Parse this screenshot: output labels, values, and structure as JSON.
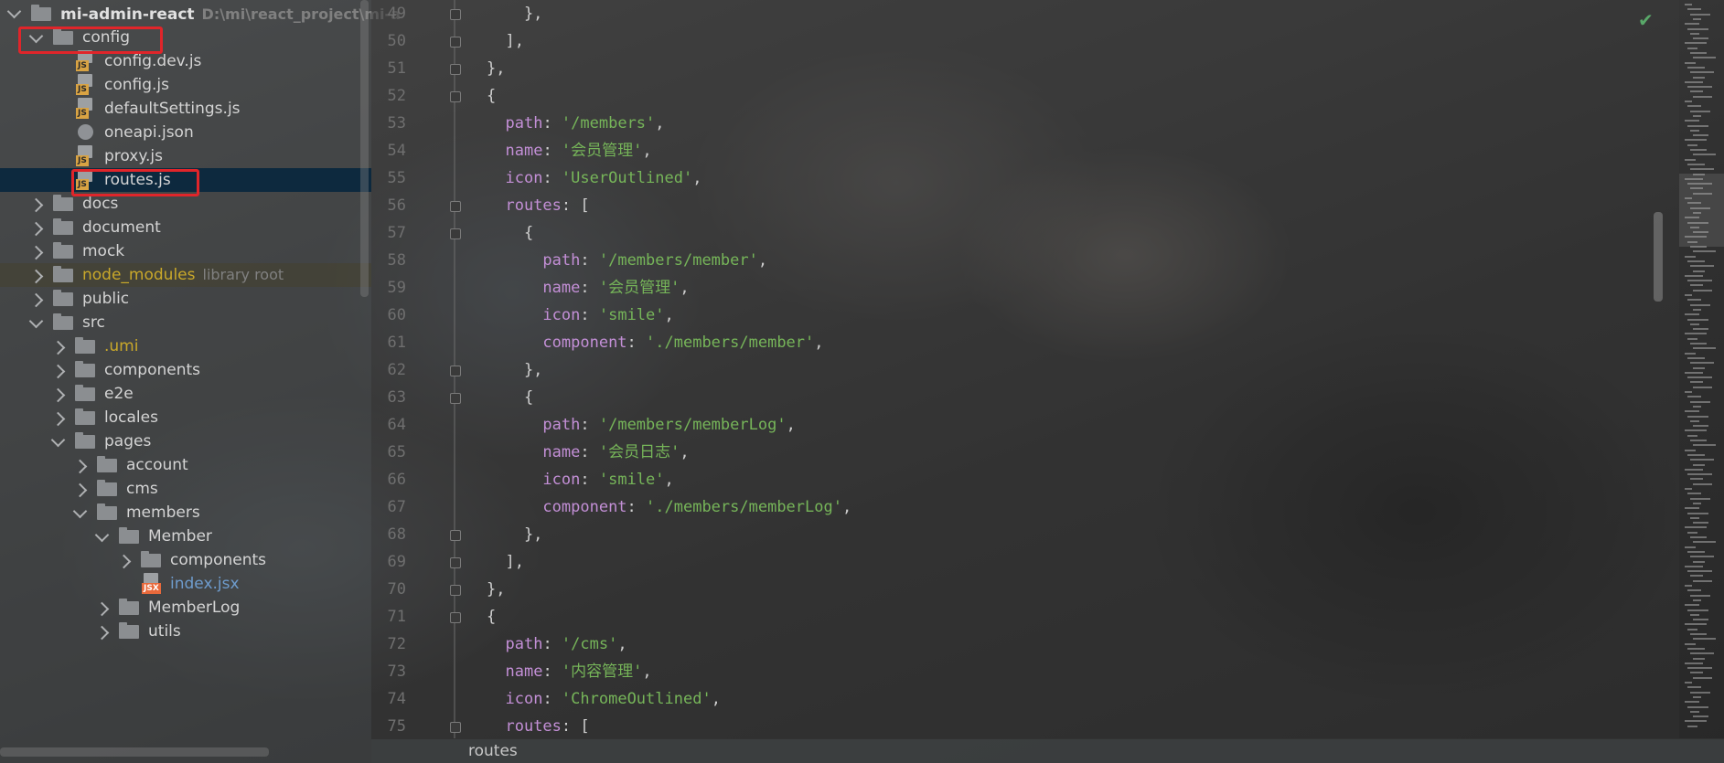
{
  "project_tree": {
    "root": {
      "name": "mi-admin-react",
      "path": "D:\\mi\\react_project\\mi-a"
    },
    "items": [
      {
        "label": "config",
        "kind": "folder",
        "expanded": true,
        "depth": 1
      },
      {
        "label": "config.dev.js",
        "kind": "js",
        "depth": 2
      },
      {
        "label": "config.js",
        "kind": "js",
        "depth": 2
      },
      {
        "label": "defaultSettings.js",
        "kind": "js",
        "depth": 2
      },
      {
        "label": "oneapi.json",
        "kind": "json",
        "depth": 2
      },
      {
        "label": "proxy.js",
        "kind": "js",
        "depth": 2
      },
      {
        "label": "routes.js",
        "kind": "js",
        "depth": 2,
        "selected": true
      },
      {
        "label": "docs",
        "kind": "folder",
        "expanded": false,
        "depth": 1
      },
      {
        "label": "document",
        "kind": "folder",
        "expanded": false,
        "depth": 1
      },
      {
        "label": "mock",
        "kind": "folder",
        "expanded": false,
        "depth": 1
      },
      {
        "label": "node_modules",
        "secondary": "library root",
        "kind": "folder",
        "expanded": false,
        "depth": 1
      },
      {
        "label": "public",
        "kind": "folder",
        "expanded": false,
        "depth": 1
      },
      {
        "label": "src",
        "kind": "folder",
        "expanded": true,
        "depth": 1
      },
      {
        "label": ".umi",
        "kind": "folder",
        "expanded": false,
        "depth": 2
      },
      {
        "label": "components",
        "kind": "folder",
        "expanded": false,
        "depth": 2
      },
      {
        "label": "e2e",
        "kind": "folder",
        "expanded": false,
        "depth": 2
      },
      {
        "label": "locales",
        "kind": "folder",
        "expanded": false,
        "depth": 2
      },
      {
        "label": "pages",
        "kind": "folder",
        "expanded": true,
        "depth": 2
      },
      {
        "label": "account",
        "kind": "folder",
        "expanded": false,
        "depth": 3
      },
      {
        "label": "cms",
        "kind": "folder",
        "expanded": false,
        "depth": 3
      },
      {
        "label": "members",
        "kind": "folder",
        "expanded": true,
        "depth": 3
      },
      {
        "label": "Member",
        "kind": "folder",
        "expanded": true,
        "depth": 4
      },
      {
        "label": "components",
        "kind": "folder",
        "expanded": false,
        "depth": 5
      },
      {
        "label": "index.jsx",
        "kind": "jsx",
        "depth": 5
      },
      {
        "label": "MemberLog",
        "kind": "folder",
        "expanded": false,
        "depth": 4
      },
      {
        "label": "utils",
        "kind": "folder",
        "expanded": false,
        "depth": 4
      }
    ]
  },
  "editor": {
    "lines": [
      {
        "n": "49",
        "code": "    },",
        "tokens": []
      },
      {
        "n": "50",
        "code": "  ],",
        "tokens": []
      },
      {
        "n": "51",
        "code": "},",
        "tokens": []
      },
      {
        "n": "52",
        "code": "{",
        "tokens": []
      },
      {
        "n": "53",
        "indent": "  ",
        "key": "path",
        "value": "'/members'",
        "tail": ","
      },
      {
        "n": "54",
        "indent": "  ",
        "key": "name",
        "value": "'会员管理'",
        "tail": ","
      },
      {
        "n": "55",
        "indent": "  ",
        "key": "icon",
        "value": "'UserOutlined'",
        "tail": ","
      },
      {
        "n": "56",
        "indent": "  ",
        "key": "routes",
        "value": "",
        "tail": " ["
      },
      {
        "n": "57",
        "code": "    {",
        "tokens": []
      },
      {
        "n": "58",
        "indent": "      ",
        "key": "path",
        "value": "'/members/member'",
        "tail": ","
      },
      {
        "n": "59",
        "indent": "      ",
        "key": "name",
        "value": "'会员管理'",
        "tail": ","
      },
      {
        "n": "60",
        "indent": "      ",
        "key": "icon",
        "value": "'smile'",
        "tail": ","
      },
      {
        "n": "61",
        "indent": "      ",
        "key": "component",
        "value": "'./members/member'",
        "tail": ","
      },
      {
        "n": "62",
        "code": "    },",
        "tokens": []
      },
      {
        "n": "63",
        "code": "    {",
        "tokens": []
      },
      {
        "n": "64",
        "indent": "      ",
        "key": "path",
        "value": "'/members/memberLog'",
        "tail": ","
      },
      {
        "n": "65",
        "indent": "      ",
        "key": "name",
        "value": "'会员日志'",
        "tail": ","
      },
      {
        "n": "66",
        "indent": "      ",
        "key": "icon",
        "value": "'smile'",
        "tail": ","
      },
      {
        "n": "67",
        "indent": "      ",
        "key": "component",
        "value": "'./members/memberLog'",
        "tail": ","
      },
      {
        "n": "68",
        "code": "    },",
        "tokens": []
      },
      {
        "n": "69",
        "code": "  ],",
        "tokens": []
      },
      {
        "n": "70",
        "code": "},",
        "tokens": []
      },
      {
        "n": "71",
        "code": "{",
        "tokens": []
      },
      {
        "n": "72",
        "indent": "  ",
        "key": "path",
        "value": "'/cms'",
        "tail": ","
      },
      {
        "n": "73",
        "indent": "  ",
        "key": "name",
        "value": "'内容管理'",
        "tail": ","
      },
      {
        "n": "74",
        "indent": "  ",
        "key": "icon",
        "value": "'ChromeOutlined'",
        "tail": ","
      },
      {
        "n": "75",
        "indent": "  ",
        "key": "routes",
        "value": "",
        "tail": " ["
      }
    ],
    "inspection_icon": "check-icon"
  },
  "breadcrumb": {
    "item": "routes"
  },
  "colors": {
    "selection": "#0d293e",
    "highlight_box": "#e0252a",
    "keyword": "#c38fd6",
    "string": "#76b559",
    "line_number": "#6f6f6f"
  }
}
